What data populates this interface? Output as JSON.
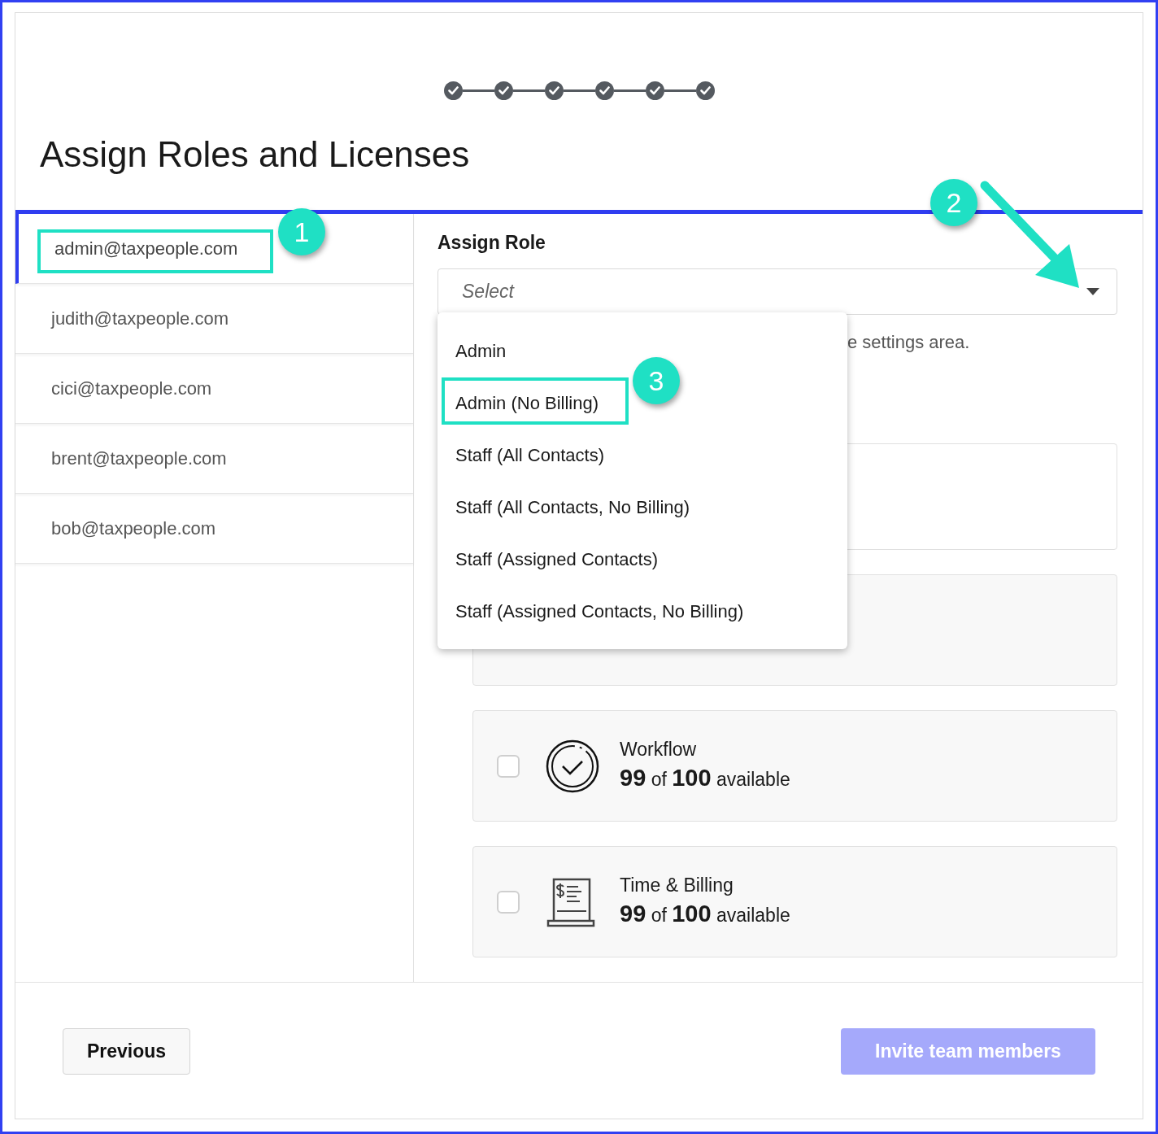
{
  "stepper": {
    "steps": [
      {
        "completed": true
      },
      {
        "completed": true
      },
      {
        "completed": true
      },
      {
        "completed": true
      },
      {
        "completed": true
      },
      {
        "completed": true
      }
    ]
  },
  "title": "Assign Roles and Licenses",
  "users": [
    {
      "email": "admin@taxpeople.com",
      "selected": true,
      "annotation": "1"
    },
    {
      "email": "judith@taxpeople.com",
      "selected": false
    },
    {
      "email": "cici@taxpeople.com",
      "selected": false
    },
    {
      "email": "brent@taxpeople.com",
      "selected": false
    },
    {
      "email": "bob@taxpeople.com",
      "selected": false
    }
  ],
  "role": {
    "label": "Assign Role",
    "placeholder": "Select",
    "helper_text": "e settings area.",
    "annotation": "2"
  },
  "dropdown": {
    "expanded": true,
    "options": [
      {
        "label": "Admin"
      },
      {
        "label": "Admin (No Billing)",
        "annotation": "3"
      },
      {
        "label": "Staff (All Contacts)"
      },
      {
        "label": "Staff (All Contacts, No Billing)"
      },
      {
        "label": "Staff (Assigned Contacts)"
      },
      {
        "label": "Staff (Assigned Contacts, No Billing)"
      }
    ]
  },
  "licenses": [
    {
      "kind": "covered"
    },
    {
      "kind": "covered"
    },
    {
      "kind": "workflow",
      "name": "Workflow",
      "availability": "**99** of **100** available",
      "checked": false
    },
    {
      "kind": "billing",
      "name": "Time & Billing",
      "availability": "**99** of **100** available",
      "checked": false
    }
  ],
  "buttons": {
    "previous": {
      "label": "Previous"
    },
    "invite": {
      "label": "Invite team members",
      "disabled": true
    }
  }
}
